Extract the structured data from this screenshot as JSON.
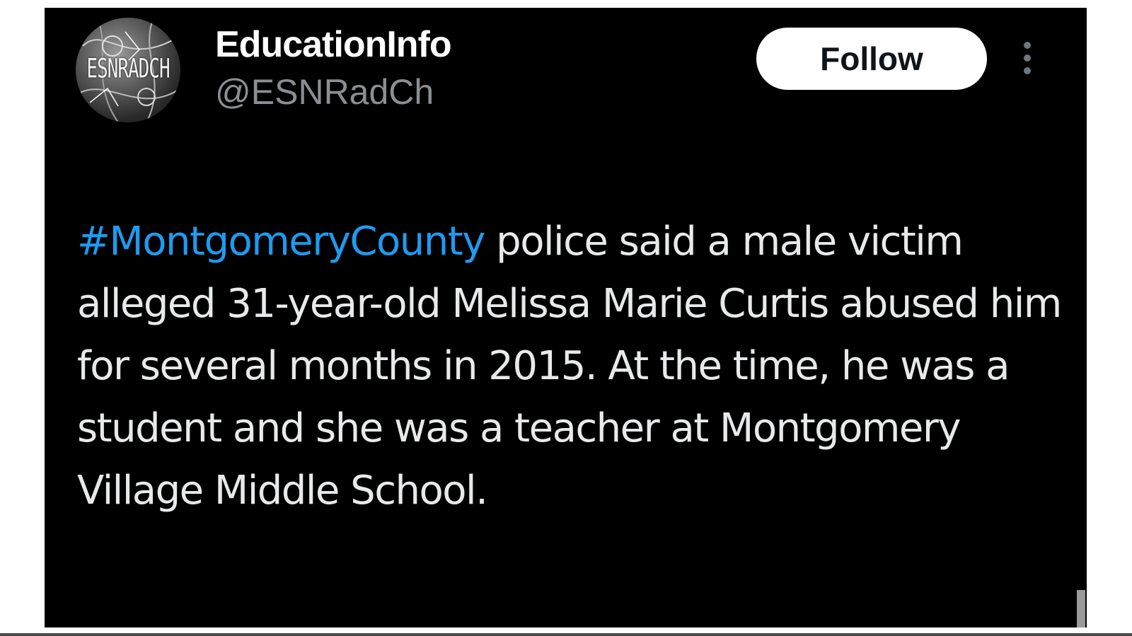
{
  "profile": {
    "display_name": "EducationInfo",
    "handle": "@ESNRadCh",
    "avatar_text": "ESNRADCH"
  },
  "actions": {
    "follow_label": "Follow",
    "more_icon": "more-vertical-icon"
  },
  "tweet": {
    "hashtag": "#MontgomeryCounty",
    "body": " police said a male victim alleged 31-year-old Melissa Marie Curtis abused him for several months in 2015. At the time, he was a student and she was a teacher at Montgomery Village Middle School."
  },
  "colors": {
    "background": "#000000",
    "text": "#e7e9ea",
    "secondary_text": "#8b8f94",
    "hashtag": "#1d9bf0",
    "button": "#ffffff"
  }
}
